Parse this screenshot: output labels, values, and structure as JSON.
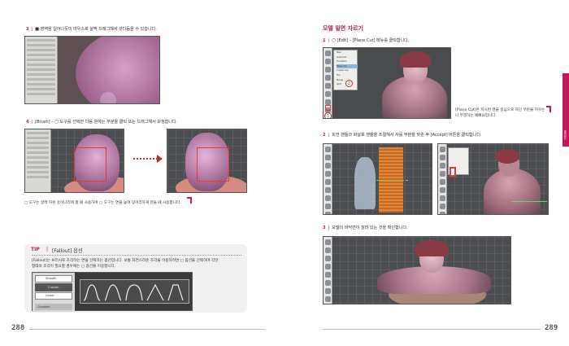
{
  "left_page": {
    "step3": {
      "num": "3",
      "text": "■ 영역을 일어나듯이 마우스로 살짝 드래그해서 갖다듬을 수 있습니다."
    },
    "step4": {
      "num": "4",
      "text": "[Brush] – ▢ 도구를 선택한 다음 원하는 부분을 클릭 또는 드래그해서 보정합니다."
    },
    "note": "▢ 도구는 살짝 하위 승이나리에 할 때 사용하며 ▢ 도구는 면을 높여 덩어리하게 만들 때 사용합니다.",
    "tip": {
      "badge": "TIP",
      "title": "[Fallout] 옵션",
      "body1": "[Fallout]는 브러시로 조각하는 면을 선택하는 옵션입니다. 보통 자연스러운 조각을 이용하려면 ▢ 옵션을 선택하며 각진",
      "body2": "형태의 조각이 필요할 경우에는 ▢ 옵션을 이용합니다.",
      "menu": [
        "Smooth",
        "Custom",
        "Linear",
        "Constant"
      ]
    },
    "page_number": "288"
  },
  "right_page": {
    "heading": "모델 밑면 자르기",
    "step1": {
      "num": "1",
      "text": "▢ [Edit] – [Plane Cut] 메뉴를 클릭합니다."
    },
    "note1a": "[Plane Cut]은 지시된 면을 중심으로 하단 부분을 지우는",
    "note1b": "나 뚜껑하는 예뻐요입니다.",
    "step2": {
      "num": "2",
      "text": "회전 핸들과 화살표 핸들을 조절해서 자를 부분을 맞춘 후 [Accept] 버튼을 클릭합니다."
    },
    "step3": {
      "num": "3",
      "text": "모델의 바닥면이 잘려 있는 것을 확인합니다."
    },
    "menu": [
      "New",
      "Duplicate",
      "Transform",
      "Plane Cut",
      "Create Cap",
      "Flip",
      "Merge",
      "Split"
    ],
    "callouts": [
      "1",
      "2"
    ],
    "side_tab": "MEDIA",
    "page_number": "289"
  },
  "colors": {
    "accent": "#c2185b",
    "tip_bg": "#f1f1f1"
  }
}
